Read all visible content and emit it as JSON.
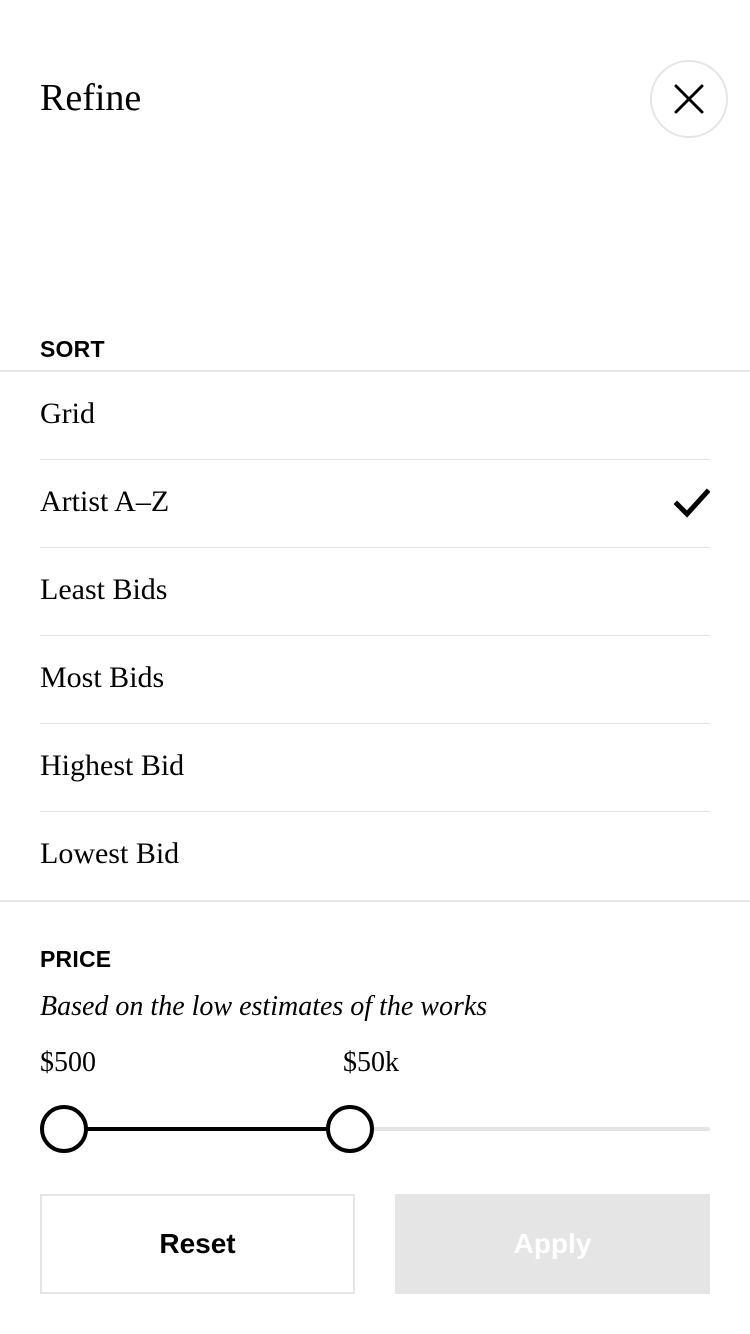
{
  "header": {
    "title": "Refine",
    "close_icon": "close-icon"
  },
  "sort": {
    "label": "SORT",
    "selected_index": 1,
    "items": [
      {
        "label": "Grid",
        "selected": false
      },
      {
        "label": "Artist A–Z",
        "selected": true
      },
      {
        "label": "Least Bids",
        "selected": false
      },
      {
        "label": "Most Bids",
        "selected": false
      },
      {
        "label": "Highest Bid",
        "selected": false
      },
      {
        "label": "Lowest Bid",
        "selected": false
      }
    ],
    "check_icon": "checkmark-icon"
  },
  "price": {
    "label": "PRICE",
    "subtitle": "Based on the low estimates of the works",
    "min_label": "$500",
    "max_label": "$50k",
    "range_min_fraction": 0.0,
    "range_max_fraction": 0.46
  },
  "actions": {
    "reset_label": "Reset",
    "apply_label": "Apply"
  },
  "colors": {
    "text": "#000000",
    "divider": "#e5e5e5",
    "apply_disabled_bg": "#e5e5e5",
    "apply_disabled_text": "#ffffff"
  }
}
